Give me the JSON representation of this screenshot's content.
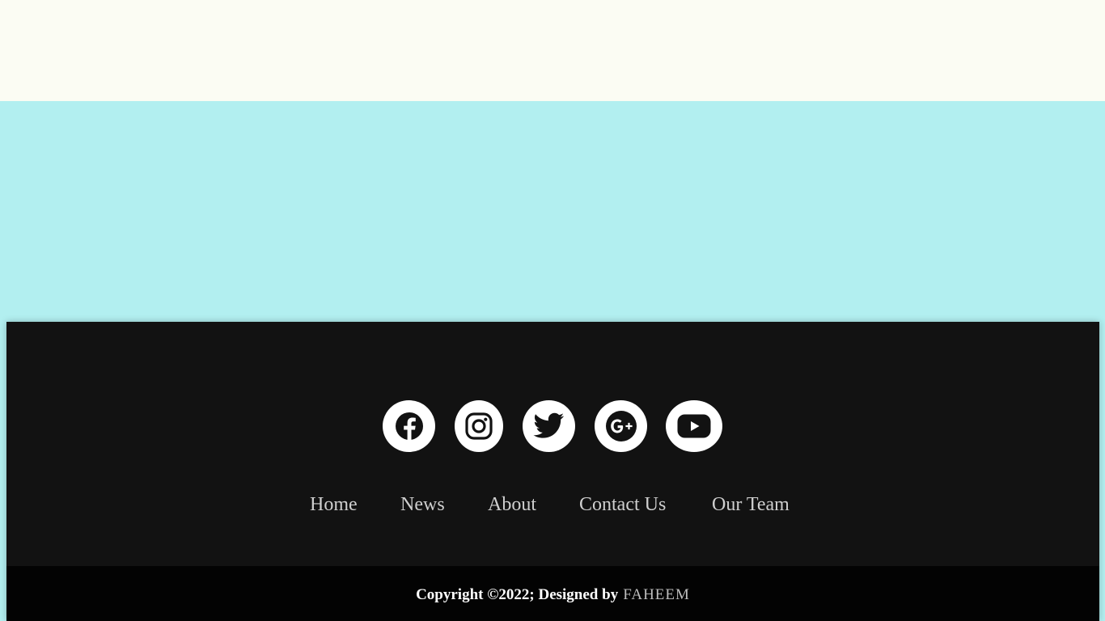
{
  "colors": {
    "top_band": "#fbfcf3",
    "hero_band": "#b2eff0",
    "footer_bg": "#121212",
    "copyright_bg": "#030303",
    "icon_bg": "#ffffff",
    "icon_fg": "#121212",
    "nav_text": "#cfcfcf",
    "copyright_text": "#ffffff",
    "designer_text": "#bdbdbd"
  },
  "footer": {
    "social": [
      {
        "icon": "facebook-icon"
      },
      {
        "icon": "instagram-icon"
      },
      {
        "icon": "twitter-icon"
      },
      {
        "icon": "google-plus-icon"
      },
      {
        "icon": "youtube-icon"
      }
    ],
    "nav": [
      "Home",
      "News",
      "About",
      "Contact Us",
      "Our Team"
    ],
    "copyright": {
      "text": "Copyright ©2022; Designed by",
      "designer": "FAHEEM"
    }
  }
}
